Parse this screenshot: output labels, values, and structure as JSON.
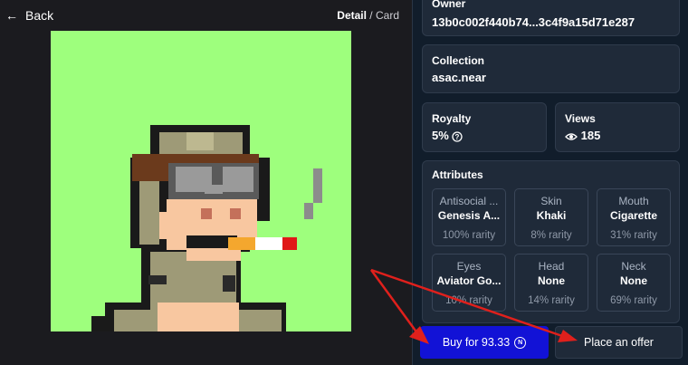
{
  "nav": {
    "back_label": "Back",
    "view_detail": "Detail",
    "view_separator": " / ",
    "view_card": "Card"
  },
  "owner": {
    "label": "Owner",
    "value": "13b0c002f440b74...3c4f9a15d71e287"
  },
  "collection": {
    "label": "Collection",
    "value": "asac.near"
  },
  "royalty": {
    "label": "Royalty",
    "value": "5%"
  },
  "views": {
    "label": "Views",
    "value": "185"
  },
  "attributes": {
    "label": "Attributes",
    "items": [
      {
        "trait": "Antisocial ...",
        "value": "Genesis A...",
        "rarity": "100% rarity"
      },
      {
        "trait": "Skin",
        "value": "Khaki",
        "rarity": "8% rarity"
      },
      {
        "trait": "Mouth",
        "value": "Cigarette",
        "rarity": "31% rarity"
      },
      {
        "trait": "Eyes",
        "value": "Aviator Go...",
        "rarity": "10% rarity"
      },
      {
        "trait": "Head",
        "value": "None",
        "rarity": "14% rarity"
      },
      {
        "trait": "Neck",
        "value": "None",
        "rarity": "69% rarity"
      }
    ]
  },
  "actions": {
    "buy_label": "Buy for 93.33",
    "offer_label": "Place an offer"
  },
  "colors": {
    "art_bg": "#9eff7d",
    "buy_bg": "#1212d6",
    "panel_bg": "#111d2b",
    "annotation_red": "#e0201c"
  }
}
